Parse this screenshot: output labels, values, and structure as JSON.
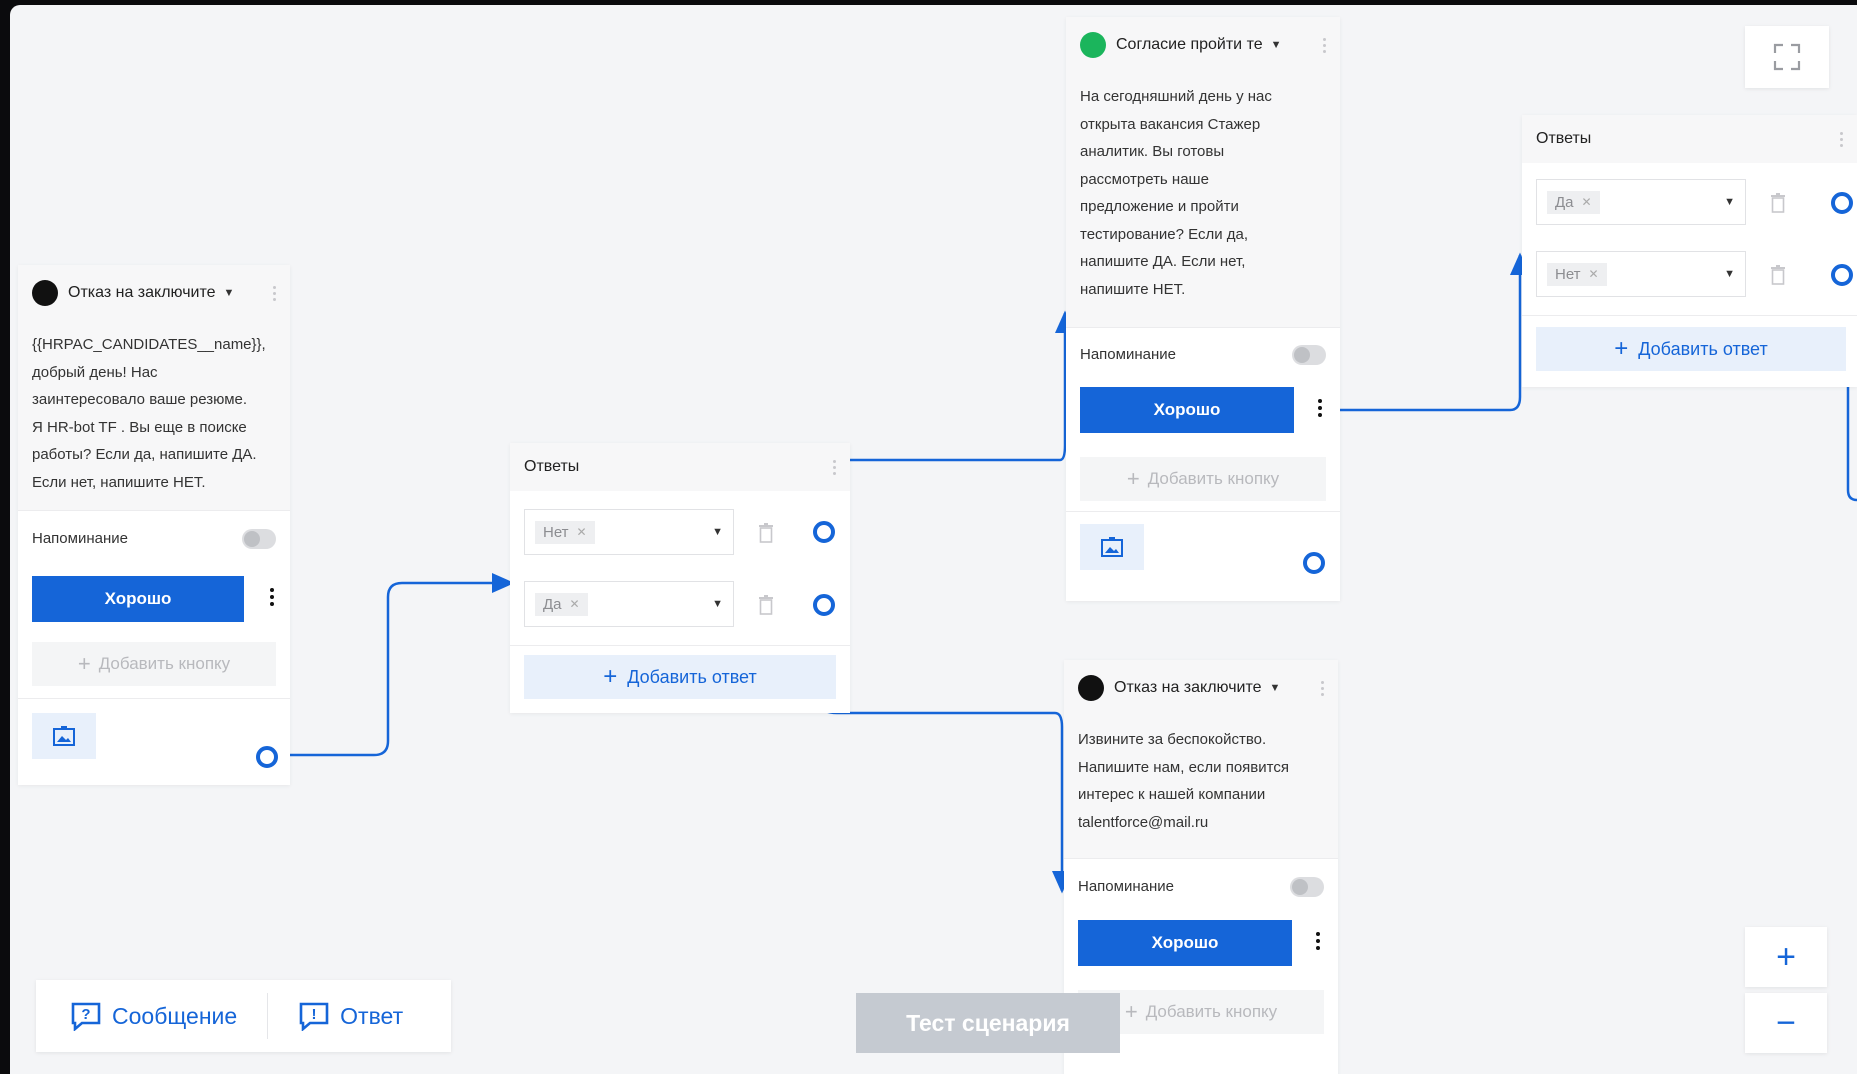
{
  "colors": {
    "accent": "#1565d8",
    "status_green": "#1bb55c",
    "status_black": "#111111"
  },
  "card1": {
    "status": "black",
    "title": "Отказ на заключите",
    "message": "{{HRPAC_CANDIDATES__name}},\nдобрый день! Нас\nзаинтересовало ваше резюме.\nЯ HR-bot TF . Вы еще в поиске\nработы? Если да, напишите ДА.\nЕсли нет, напишите НЕТ.",
    "reminder_label": "Напоминание",
    "button_label": "Хорошо",
    "add_button_label": "Добавить кнопку",
    "image_icon": "image-icon"
  },
  "answers1": {
    "header": "Ответы",
    "options": [
      {
        "value": "Нет"
      },
      {
        "value": "Да"
      }
    ],
    "add_label": "Добавить ответ"
  },
  "card2": {
    "status": "green",
    "title": "Согласие пройти те",
    "message": "На сегодняшний день у нас\nоткрыта вакансия Стажер\nаналитик. Вы готовы\nрассмотреть наше\nпредложение и пройти\nтестирование? Если да,\nнапишите ДА. Если нет,\nнапишите НЕТ.",
    "reminder_label": "Напоминание",
    "button_label": "Хорошо",
    "add_button_label": "Добавить кнопку",
    "image_icon": "image-icon"
  },
  "card3": {
    "status": "black",
    "title": "Отказ на заключите",
    "message": "Извините за беспокойство.\nНапишите нам, если появится\nинтерес к нашей компании\ntalentforce@mail.ru",
    "reminder_label": "Напоминание",
    "button_label": "Хорошо",
    "add_button_label": "Добавить кнопку"
  },
  "answers2": {
    "header": "Ответы",
    "options": [
      {
        "value": "Да"
      },
      {
        "value": "Нет"
      }
    ],
    "add_label": "Добавить ответ"
  },
  "toolbar": {
    "message_label": "Сообщение",
    "answer_label": "Ответ",
    "test_label": "Тест сценария",
    "zoom_in": "+",
    "zoom_out": "−"
  }
}
